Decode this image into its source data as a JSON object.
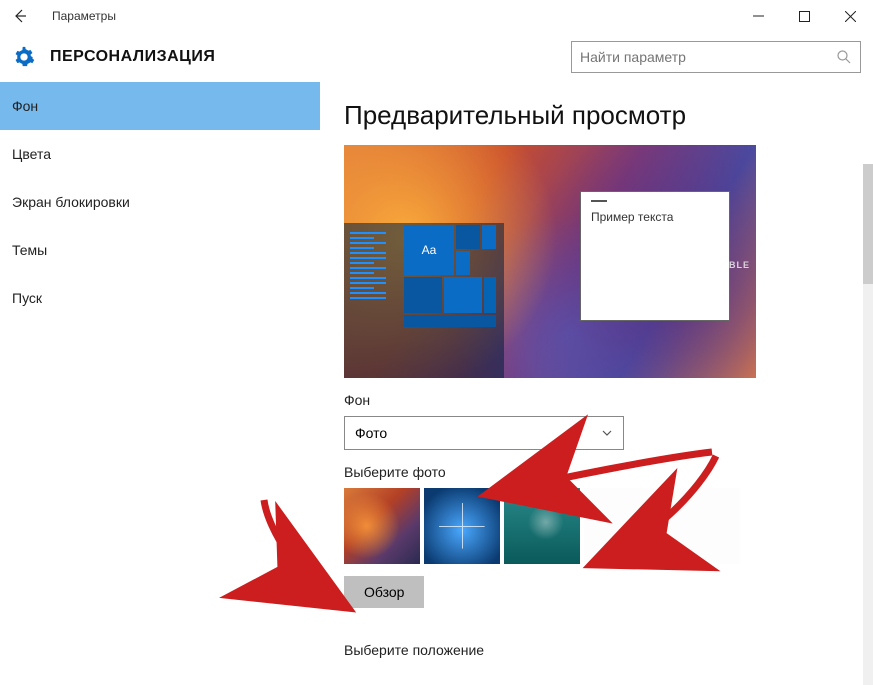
{
  "window": {
    "app_title": "Параметры"
  },
  "header": {
    "page_title": "ПЕРСОНАЛИЗАЦИЯ"
  },
  "search": {
    "placeholder": "Найти параметр"
  },
  "sidebar": {
    "items": [
      {
        "label": "Фон",
        "active": true
      },
      {
        "label": "Цвета",
        "active": false
      },
      {
        "label": "Экран блокировки",
        "active": false
      },
      {
        "label": "Темы",
        "active": false
      },
      {
        "label": "Пуск",
        "active": false
      }
    ]
  },
  "content": {
    "preview_heading": "Предварительный просмотр",
    "sample_text": "Пример текста",
    "tile_aa": "Aa",
    "side_text": "EDIBLE",
    "bg_label": "Фон",
    "bg_dropdown_value": "Фото",
    "choose_photo_label": "Выберите фото",
    "browse_button": "Обзор",
    "choose_fit_label": "Выберите положение"
  }
}
